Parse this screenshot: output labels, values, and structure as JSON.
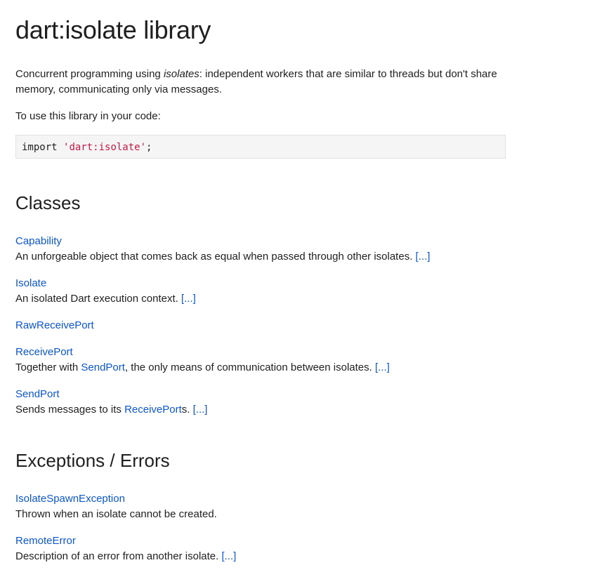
{
  "title": "dart:isolate library",
  "intro": {
    "prefix": "Concurrent programming using ",
    "emphasis": "isolates",
    "suffix": ": independent workers that are similar to threads but don't share memory, communicating only via messages."
  },
  "usage_text": "To use this library in your code:",
  "code": {
    "keyword": "import",
    "string": "'dart:isolate'",
    "terminator": ";"
  },
  "classes": {
    "heading": "Classes",
    "items": [
      {
        "name": "Capability",
        "desc_before": "An unforgeable object that comes back as equal when passed through other isolates. ",
        "more": "[...]"
      },
      {
        "name": "Isolate",
        "desc_before": "An isolated Dart execution context. ",
        "more": "[...]"
      },
      {
        "name": "RawReceivePort"
      },
      {
        "name": "ReceivePort",
        "desc_before": "Together with ",
        "link": "SendPort",
        "desc_after": ", the only means of communication between isolates. ",
        "more": "[...]"
      },
      {
        "name": "SendPort",
        "desc_before": "Sends messages to its ",
        "link": "ReceivePort",
        "desc_after": "s. ",
        "more": "[...]"
      }
    ]
  },
  "exceptions": {
    "heading": "Exceptions / Errors",
    "items": [
      {
        "name": "IsolateSpawnException",
        "desc_before": "Thrown when an isolate cannot be created."
      },
      {
        "name": "RemoteError",
        "desc_before": "Description of an error from another isolate. ",
        "more": "[...]"
      }
    ]
  }
}
